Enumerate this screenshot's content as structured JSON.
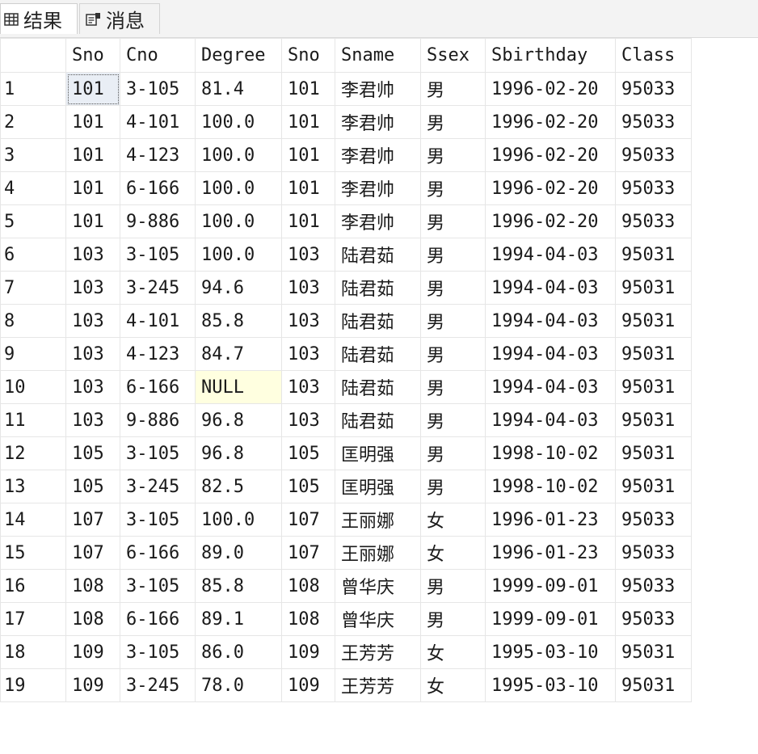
{
  "tabs": [
    {
      "label": "结果",
      "icon": "grid-icon"
    },
    {
      "label": "消息",
      "icon": "messages-icon"
    }
  ],
  "grid": {
    "columns": [
      "",
      "Sno",
      "Cno",
      "Degree",
      "Sno",
      "Sname",
      "Ssex",
      "Sbirthday",
      "Class"
    ],
    "rows": [
      [
        "1",
        "101",
        "3-105",
        "81.4",
        "101",
        "李君帅",
        "男",
        "1996-02-20",
        "95033"
      ],
      [
        "2",
        "101",
        "4-101",
        "100.0",
        "101",
        "李君帅",
        "男",
        "1996-02-20",
        "95033"
      ],
      [
        "3",
        "101",
        "4-123",
        "100.0",
        "101",
        "李君帅",
        "男",
        "1996-02-20",
        "95033"
      ],
      [
        "4",
        "101",
        "6-166",
        "100.0",
        "101",
        "李君帅",
        "男",
        "1996-02-20",
        "95033"
      ],
      [
        "5",
        "101",
        "9-886",
        "100.0",
        "101",
        "李君帅",
        "男",
        "1996-02-20",
        "95033"
      ],
      [
        "6",
        "103",
        "3-105",
        "100.0",
        "103",
        "陆君茹",
        "男",
        "1994-04-03",
        "95031"
      ],
      [
        "7",
        "103",
        "3-245",
        "94.6",
        "103",
        "陆君茹",
        "男",
        "1994-04-03",
        "95031"
      ],
      [
        "8",
        "103",
        "4-101",
        "85.8",
        "103",
        "陆君茹",
        "男",
        "1994-04-03",
        "95031"
      ],
      [
        "9",
        "103",
        "4-123",
        "84.7",
        "103",
        "陆君茹",
        "男",
        "1994-04-03",
        "95031"
      ],
      [
        "10",
        "103",
        "6-166",
        "NULL",
        "103",
        "陆君茹",
        "男",
        "1994-04-03",
        "95031"
      ],
      [
        "11",
        "103",
        "9-886",
        "96.8",
        "103",
        "陆君茹",
        "男",
        "1994-04-03",
        "95031"
      ],
      [
        "12",
        "105",
        "3-105",
        "96.8",
        "105",
        "匡明强",
        "男",
        "1998-10-02",
        "95031"
      ],
      [
        "13",
        "105",
        "3-245",
        "82.5",
        "105",
        "匡明强",
        "男",
        "1998-10-02",
        "95031"
      ],
      [
        "14",
        "107",
        "3-105",
        "100.0",
        "107",
        "王丽娜",
        "女",
        "1996-01-23",
        "95033"
      ],
      [
        "15",
        "107",
        "6-166",
        "89.0",
        "107",
        "王丽娜",
        "女",
        "1996-01-23",
        "95033"
      ],
      [
        "16",
        "108",
        "3-105",
        "85.8",
        "108",
        "曾华庆",
        "男",
        "1999-09-01",
        "95033"
      ],
      [
        "17",
        "108",
        "6-166",
        "89.1",
        "108",
        "曾华庆",
        "男",
        "1999-09-01",
        "95033"
      ],
      [
        "18",
        "109",
        "3-105",
        "86.0",
        "109",
        "王芳芳",
        "女",
        "1995-03-10",
        "95031"
      ],
      [
        "19",
        "109",
        "3-245",
        "78.0",
        "109",
        "王芳芳",
        "女",
        "1995-03-10",
        "95031"
      ]
    ]
  },
  "colors": {
    "null_highlight": "#ffffe0",
    "selected_cell": "#e9eef5"
  }
}
